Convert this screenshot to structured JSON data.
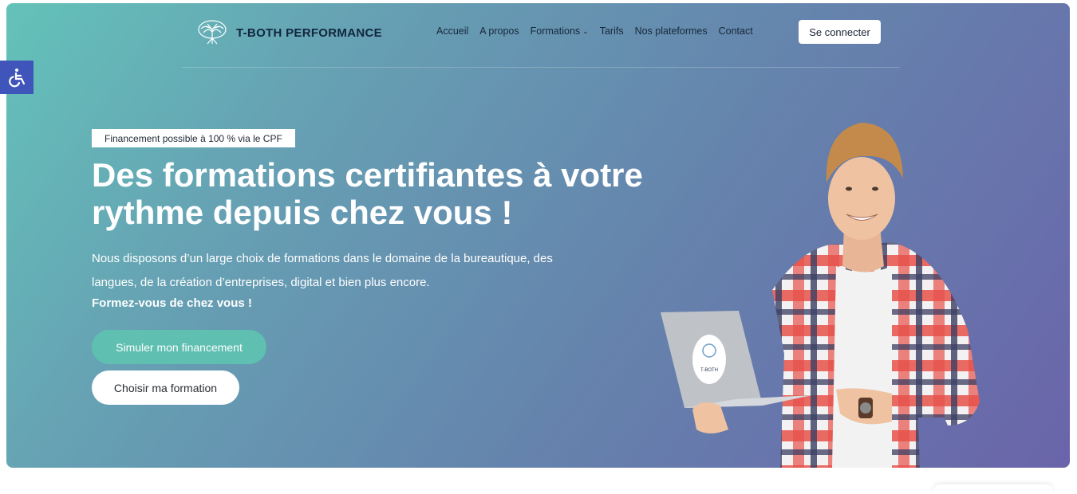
{
  "brand": {
    "name": "T-BOTH PERFORMANCE",
    "logo_icon": "tree-brain-icon"
  },
  "nav": {
    "items": [
      {
        "label": "Accueil"
      },
      {
        "label": "A propos"
      },
      {
        "label": "Formations",
        "has_dropdown": true
      },
      {
        "label": "Tarifs"
      },
      {
        "label": "Nos plateformes"
      },
      {
        "label": "Contact"
      }
    ],
    "login_label": "Se connecter"
  },
  "hero": {
    "badge": "Financement possible à 100 % via le CPF",
    "title": "Des formations certifiantes à votre rythme depuis chez vous !",
    "description": "Nous disposons d’un large choix de formations dans le domaine de la bureautique, des langues, de la création d’entreprises, digital et bien plus encore.",
    "description_bold": "Formez-vous de chez vous !",
    "primary_button": "Simuler mon financement",
    "secondary_button": "Choisir ma formation",
    "laptop_sticker": "T-BOTH"
  },
  "accessibility": {
    "icon": "wheelchair-icon"
  },
  "colors": {
    "gradient_start": "#64c2b9",
    "gradient_end": "#6a64aa",
    "primary_button": "#5fbfb1",
    "brand_text": "#12253d",
    "accessibility_bg": "#4055b9"
  }
}
